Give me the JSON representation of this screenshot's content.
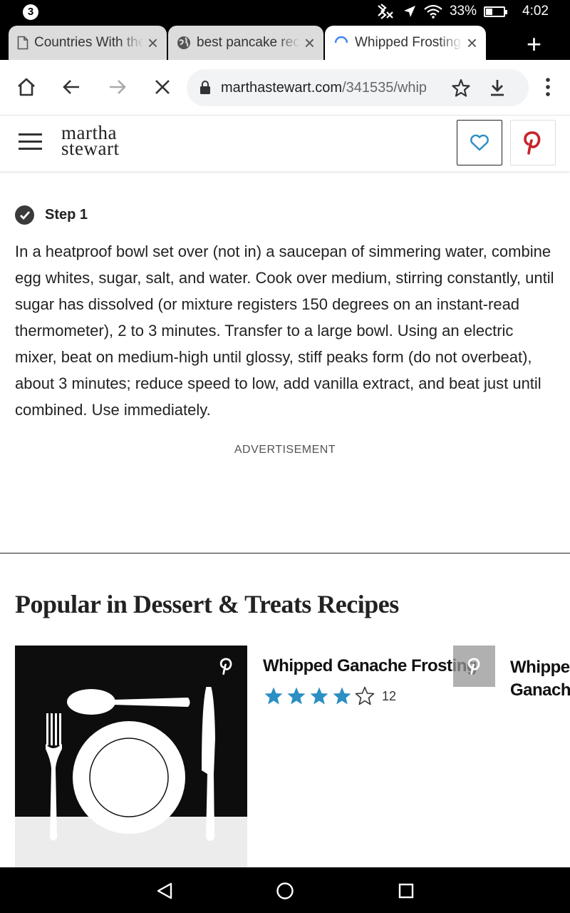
{
  "status_bar": {
    "notification_count": "3",
    "battery_percent": "33%",
    "battery_level": 0.33,
    "time": "4:02",
    "icons": [
      "bluetooth-muted-icon",
      "location-icon",
      "wifi-icon",
      "battery-icon"
    ]
  },
  "tabs": [
    {
      "title": "Countries With the",
      "icon": "page-icon",
      "active": false
    },
    {
      "title": "best pancake recipe",
      "icon": "globe-icon",
      "active": false
    },
    {
      "title": "Whipped Frosting",
      "icon": "loading-spinner-icon",
      "active": true
    }
  ],
  "toolbar": {
    "url_domain": "marthastewart.com",
    "url_path": "/341535/whip",
    "icons": [
      "home-icon",
      "back-icon",
      "forward-icon",
      "stop-icon",
      "lock-icon",
      "star-icon",
      "download-icon",
      "more-icon"
    ]
  },
  "site": {
    "logo_line1": "martha",
    "logo_line2": "stewart"
  },
  "step": {
    "label": "Step 1",
    "text": "In a heatproof bowl set over (not in) a saucepan of simmering water, combine egg whites, sugar, salt, and water. Cook over medium, stirring constantly, until sugar has dissolved (or mixture registers 150 degrees on an instant-read thermometer), 2 to 3 minutes. Transfer to a large bowl. Using an electric mixer, beat on medium-high until glossy, stiff peaks form (do not overbeat), about 3 minutes; reduce speed to low, add vanilla extract, and beat just until combined. Use immediately."
  },
  "advertisement_label": "ADVERTISEMENT",
  "popular": {
    "title": "Popular in Dessert & Treats Recipes",
    "cards": [
      {
        "title": "Whipped Ganache Frosting",
        "rating": 4,
        "rating_max": 5,
        "rating_count": "12"
      },
      {
        "title_line1": "Whipped",
        "title_line2": "Ganache"
      }
    ]
  },
  "colors": {
    "star": "#2b8fc4",
    "pinterest": "#c8232c",
    "heart": "#2b8fc4"
  }
}
